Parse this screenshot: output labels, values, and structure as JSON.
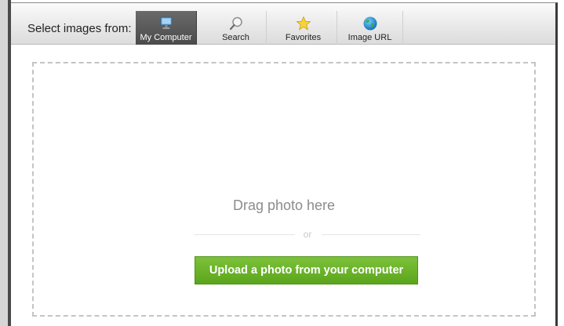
{
  "toolbar": {
    "label": "Select images from:",
    "tabs": [
      {
        "label": "My Computer",
        "icon": "computer-monitor-icon",
        "active": true
      },
      {
        "label": "Search",
        "icon": "magnifier-icon",
        "active": false
      },
      {
        "label": "Favorites",
        "icon": "star-icon",
        "active": false
      },
      {
        "label": "Image URL",
        "icon": "globe-icon",
        "active": false
      }
    ]
  },
  "dropzone": {
    "drag_text": "Drag photo here",
    "or_text": "or",
    "upload_button": "Upload a photo from your computer"
  },
  "colors": {
    "upload_green": "#66b128",
    "active_tab": "#555555",
    "dashed_border": "#c4c4c4"
  }
}
